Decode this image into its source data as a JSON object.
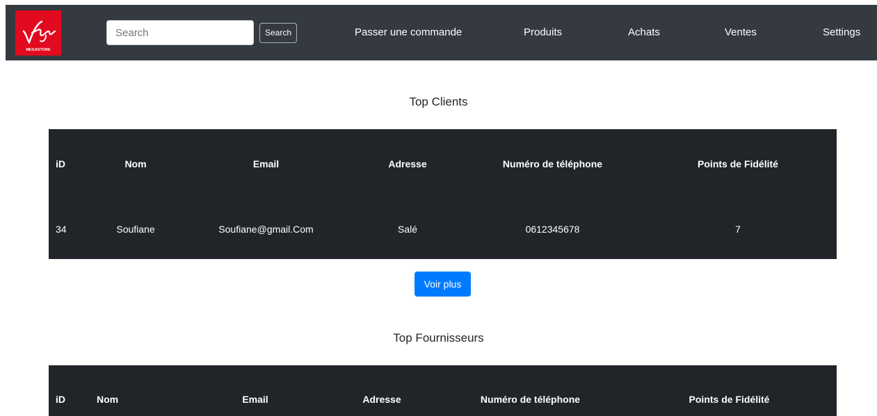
{
  "brand": {
    "logo_text": "Virgin",
    "logo_subtext": "MEGASTORE",
    "logo_color": "#e10a1e"
  },
  "navbar": {
    "background": "#343a40",
    "search": {
      "placeholder": "Search",
      "value": "",
      "button_label": "Search"
    },
    "links": [
      {
        "label": "Passer une commande"
      },
      {
        "label": "Produits"
      },
      {
        "label": "Achats"
      },
      {
        "label": "Ventes"
      },
      {
        "label": "Settings"
      }
    ]
  },
  "clients": {
    "title": "Top Clients",
    "columns": [
      "iD",
      "Nom",
      "Email",
      "Adresse",
      "Numéro de téléphone",
      "Points de Fidélité"
    ],
    "rows": [
      [
        "34",
        "Soufiane",
        "Soufiane@gmail.Com",
        "Salé",
        "0612345678",
        "7"
      ]
    ],
    "more_label": "Voir plus"
  },
  "fournisseurs": {
    "title": "Top Fournisseurs",
    "columns": [
      "iD",
      "Nom",
      "Email",
      "Adresse",
      "Numéro de téléphone",
      "Points de Fidélité"
    ]
  },
  "colors": {
    "table_bg": "#212529",
    "primary_button": "#007bff"
  }
}
